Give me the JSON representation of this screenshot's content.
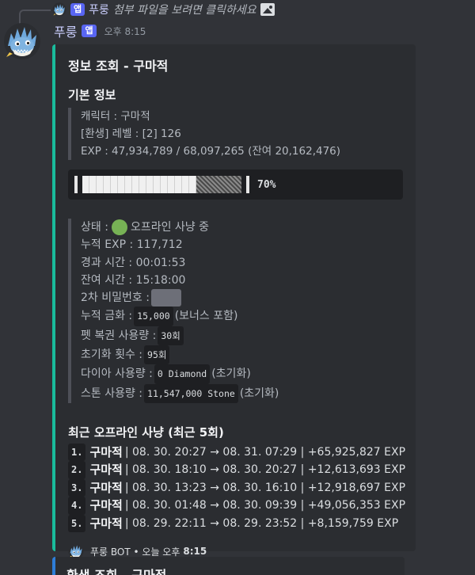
{
  "reply": {
    "bot_name": "푸룽",
    "app_badge": "앱",
    "text": "첨부 파일을 보려면 클릭하세요"
  },
  "message": {
    "username": "푸룽",
    "app_badge": "앱",
    "timestamp": "오후 8:15"
  },
  "embed": {
    "accent_color": "#1abc9c",
    "title": "정보 조회 - 구마적",
    "basic_info": {
      "heading": "기본 정보",
      "character": "캐릭터 : 구마적",
      "level": "[환생] 레벨 : [2] 126",
      "exp": "EXP : 47,934,789 / 68,097,265 (잔여 20,162,476)",
      "progress_percent": 70,
      "progress_label": "70%"
    },
    "status": {
      "state_label": "상태 :",
      "state_value": "오프라인 사냥 중",
      "cum_exp": "누적 EXP : 117,712",
      "elapsed": "경과 시간 : 00:01:53",
      "remaining": "잔여 시간 : 15:18:00",
      "password_label": "2차 비밀번호 :",
      "gold_label": "누적 금화 :",
      "gold_value": "15,000",
      "gold_suffix": "(보너스 포함)",
      "pet_label": "펫 복권 사용량 :",
      "pet_value": "30회",
      "reset_label": "초기화 횟수 :",
      "reset_value": "95회",
      "diamond_label": "다이아 사용량 :",
      "diamond_value": "0 Diamond",
      "diamond_suffix": "(초기화)",
      "stone_label": "스톤 사용량 :",
      "stone_value": "11,547,000 Stone",
      "stone_suffix": "(초기화)"
    },
    "recent_hunts": {
      "heading": "최근 오프라인 사냥 (최근 5회)",
      "rows": [
        {
          "num": "1.",
          "name": "구마적",
          "detail": "| 08. 30. 20:27 → 08. 31. 07:29 | +65,925,827 EXP"
        },
        {
          "num": "2.",
          "name": "구마적",
          "detail": "| 08. 30. 18:10 → 08. 30. 20:27 | +12,613,693 EXP"
        },
        {
          "num": "3.",
          "name": "구마적",
          "detail": "| 08. 30. 13:23 → 08. 30. 16:10 | +12,918,697 EXP"
        },
        {
          "num": "4.",
          "name": "구마적",
          "detail": "| 08. 30. 01:48 → 08. 30. 09:39 | +49,056,353 EXP"
        },
        {
          "num": "5.",
          "name": "구마적",
          "detail": "| 08. 29. 22:11 → 08. 29. 23:52 | +8,159,759 EXP"
        }
      ]
    },
    "footer": {
      "text": "푸룽 BOT • 오늘 오후",
      "time": "8:15"
    }
  },
  "embed2": {
    "accent_color": "#2e7dd7",
    "title": "환생 조회 - 구마적"
  }
}
